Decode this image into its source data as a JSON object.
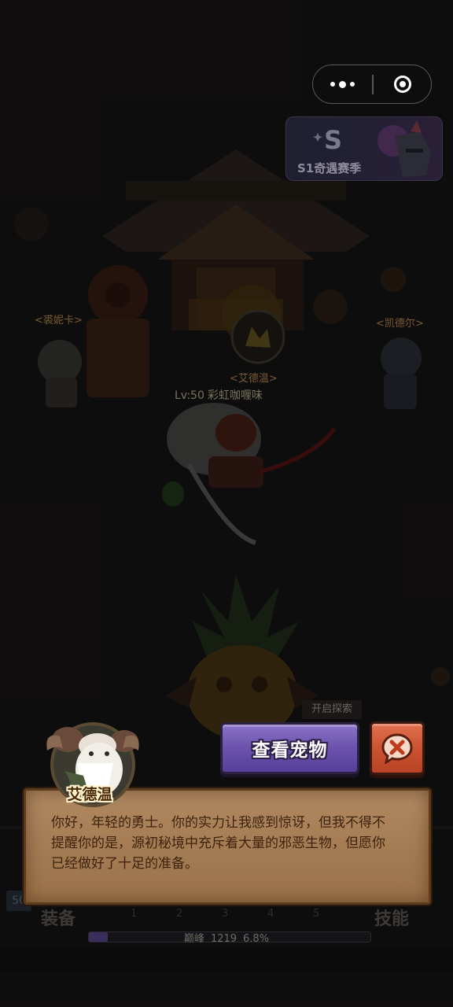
{
  "capsule": {
    "more_icon": "more-dots-icon",
    "close_icon": "target-circle-icon"
  },
  "season": {
    "label": "S1奇遇赛季"
  },
  "world": {
    "npc_left": "<裘妮卡>",
    "npc_center": "<艾德温>",
    "npc_right": "<凯德尔>",
    "player_level": "Lv:50",
    "player_name": "彩虹咖喱味",
    "explore_label": "开启探索"
  },
  "dialog": {
    "speaker": "艾德温",
    "line1": "你好，年轻的勇士。你的实力让我感到惊讶，但我不得不",
    "line2": "提醒你的是，源初秘境中充斥着大量的邪恶生物，但愿你",
    "line3": "已经做好了十足的准备。",
    "view_pets_label": "查看宠物",
    "close_icon": "close-x-icon"
  },
  "bottom": {
    "level_badge": "50",
    "equipment_tab": "装备",
    "skills_tab": "技能",
    "slots": [
      "1",
      "2",
      "3",
      "4",
      "5"
    ],
    "peak_label": "巅峰",
    "peak_value": "1219",
    "peak_percent": "6.8%",
    "peak_progress": 0.068
  },
  "colors": {
    "button_purple": "#6a52ad",
    "button_red": "#c9512f",
    "parchment": "#a37b53"
  }
}
